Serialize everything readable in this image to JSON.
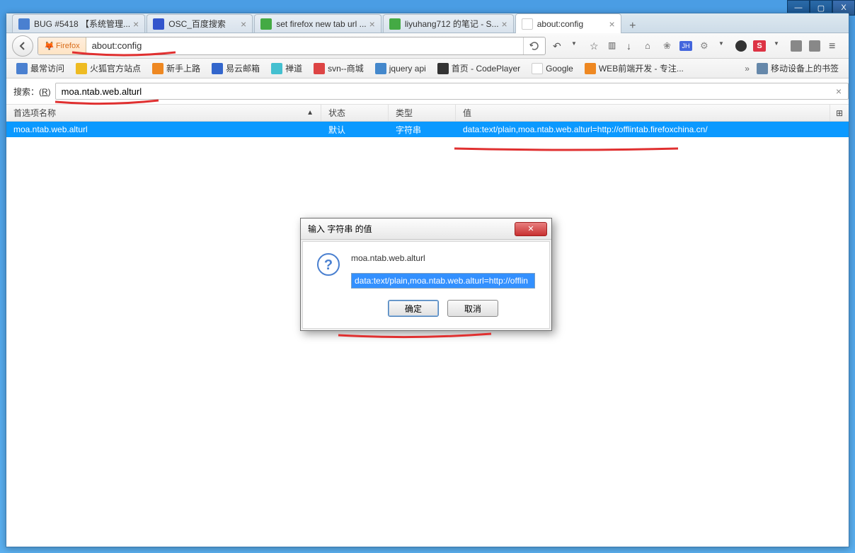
{
  "window": {
    "minimize": "—",
    "maximize": "▢",
    "close": "X"
  },
  "tabs": [
    {
      "label": "BUG #5418 【系统管理...",
      "icon": "#6699cc"
    },
    {
      "label": "OSC_百度搜索",
      "icon": "#3355cc"
    },
    {
      "label": "set firefox new tab url ...",
      "icon": "#44aa66"
    },
    {
      "label": "liyuhang712 的笔记 - S...",
      "icon": "#44aa66"
    },
    {
      "label": "about:config",
      "icon": "#fff",
      "active": true
    }
  ],
  "nav": {
    "identity": "Firefox",
    "url": "about:config"
  },
  "bookmarks": [
    {
      "label": "最常访问",
      "icon": "#4488dd"
    },
    {
      "label": "火狐官方站点",
      "icon": "#eebb44"
    },
    {
      "label": "新手上路",
      "icon": "#ee7722"
    },
    {
      "label": "易云邮箱",
      "icon": "#3366cc"
    },
    {
      "label": "禅道",
      "icon": "#44aaee"
    },
    {
      "label": "svn--商城",
      "icon": "#dd4444"
    },
    {
      "label": "jquery api",
      "icon": "#4488cc"
    },
    {
      "label": "首页 - CodePlayer",
      "icon": "#222"
    },
    {
      "label": "Google",
      "icon": "#fff"
    },
    {
      "label": "WEB前端开发 - 专注...",
      "icon": "#ee8822"
    }
  ],
  "bookmarks_more": "»",
  "bookmarks_mobile": "移动设备上的书签",
  "search": {
    "label_prefix": "搜索：(",
    "label_key": "R",
    "label_suffix": ")",
    "value": "moa.ntab.web.alturl"
  },
  "config_header": {
    "name": "首选项名称",
    "status": "状态",
    "type": "类型",
    "value": "值"
  },
  "config_row": {
    "name": "moa.ntab.web.alturl",
    "status": "默认",
    "type": "字符串",
    "value": "data:text/plain,moa.ntab.web.alturl=http://offlintab.firefoxchina.cn/"
  },
  "dialog": {
    "title": "输入 字符串 的值",
    "label": "moa.ntab.web.alturl",
    "input": "data:text/plain,moa.ntab.web.alturl=http://offlin",
    "ok": "确定",
    "cancel": "取消"
  }
}
